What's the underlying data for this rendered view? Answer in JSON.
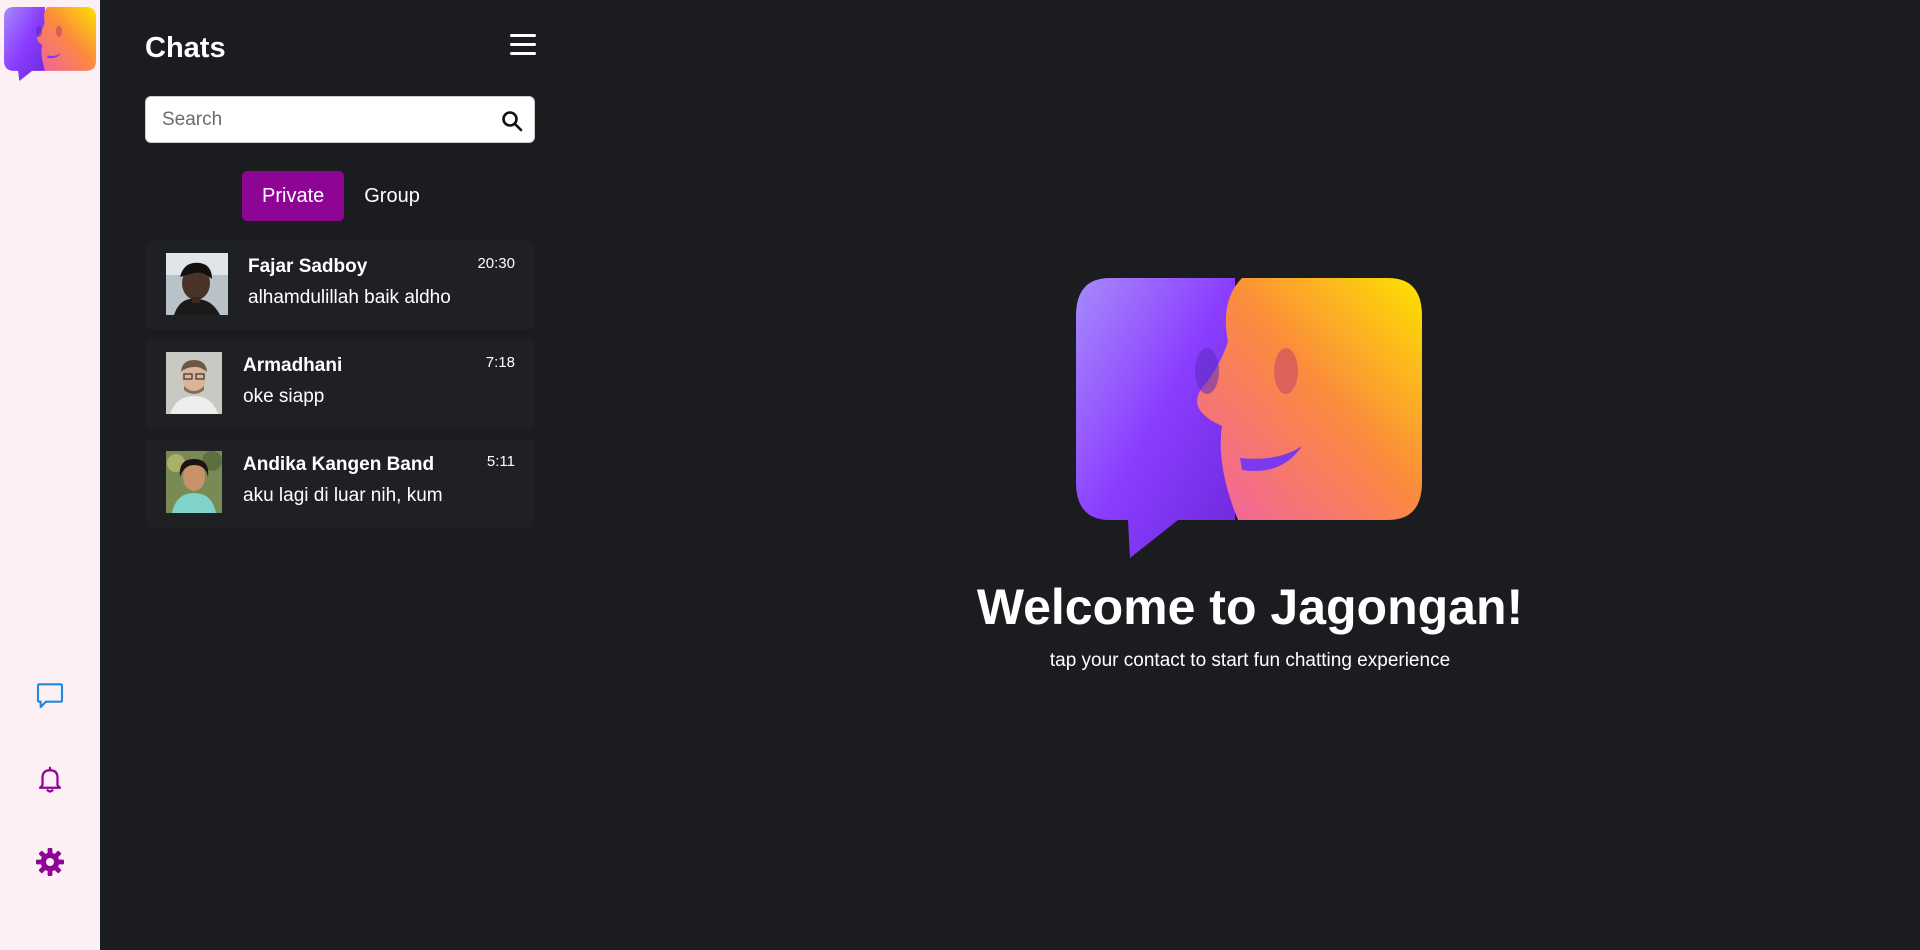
{
  "app": {
    "name": "Jagongan"
  },
  "rail": {
    "logo_icon": "jagongan-logo",
    "items": [
      {
        "name": "chats",
        "icon": "chat-bubble-icon",
        "color": "#1e88e5"
      },
      {
        "name": "notifications",
        "icon": "bell-icon",
        "color": "#8e0596"
      },
      {
        "name": "settings",
        "icon": "gear-icon",
        "color": "#8e0596"
      }
    ]
  },
  "sidebar": {
    "title": "Chats",
    "search": {
      "placeholder": "Search",
      "value": ""
    },
    "tabs": [
      {
        "label": "Private",
        "active": true
      },
      {
        "label": "Group",
        "active": false
      }
    ],
    "chats": [
      {
        "name": "Fajar Sadboy",
        "message": "alhamdulillah baik aldho",
        "time": "20:30"
      },
      {
        "name": "Armadhani",
        "message": "oke siapp",
        "time": "7:18"
      },
      {
        "name": "Andika Kangen Band",
        "message": "aku lagi di luar nih, kum",
        "time": "5:11"
      }
    ]
  },
  "main": {
    "heading": "Welcome to Jagongan!",
    "subtitle": "tap your contact to start fun chatting experience"
  },
  "colors": {
    "accent": "#8e0596",
    "background": "#1b1c20",
    "rail": "#fdf0f4",
    "chat_icon": "#1e88e5"
  }
}
